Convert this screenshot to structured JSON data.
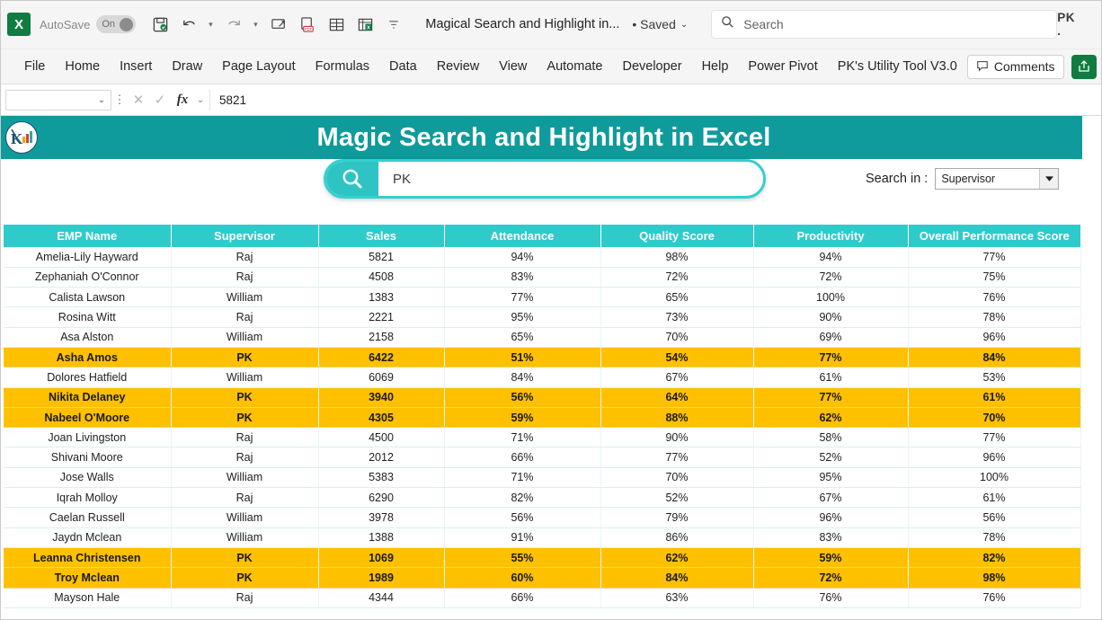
{
  "titlebar": {
    "app_icon": "excel-logo",
    "autosave_label": "AutoSave",
    "toggle_state": "On",
    "document_title": "Magical Search and Highlight in...",
    "saved_state": "• Saved",
    "search_placeholder": "Search",
    "account_initials": "PK .",
    "quick_access": [
      "save-icon",
      "undo-icon",
      "redo-icon",
      "quick-print-icon",
      "export-pdf-icon",
      "table-icon",
      "new-sheet-icon",
      "customize-qat-icon"
    ]
  },
  "ribbon": {
    "tabs": [
      {
        "label": "File"
      },
      {
        "label": "Home"
      },
      {
        "label": "Insert"
      },
      {
        "label": "Draw"
      },
      {
        "label": "Page Layout"
      },
      {
        "label": "Formulas"
      },
      {
        "label": "Data"
      },
      {
        "label": "Review"
      },
      {
        "label": "View"
      },
      {
        "label": "Automate"
      },
      {
        "label": "Developer"
      },
      {
        "label": "Help"
      },
      {
        "label": "Power Pivot"
      },
      {
        "label": "PK's Utility Tool V3.0"
      }
    ],
    "comments_label": "Comments",
    "share_label": "Share"
  },
  "formulabar": {
    "name_box_value": "",
    "cancel_icon": "cancel-icon",
    "enter_icon": "confirm-icon",
    "fx_label": "fx",
    "cell_value": "5821"
  },
  "banner": {
    "title": "Magic Search and Highlight in Excel",
    "background_color": "#0f9b9b",
    "logo": "pk-logo-icon"
  },
  "search": {
    "icon": "search-icon",
    "value": "PK",
    "accent_color": "#2fc4c4",
    "search_in_label": "Search in :",
    "search_in_value": "Supervisor"
  },
  "table": {
    "header_color": "#2fcbcb",
    "highlight_color": "#ffc000",
    "columns": [
      "EMP Name",
      "Supervisor",
      "Sales",
      "Attendance",
      "Quality Score",
      "Productivity",
      "Overall Performance Score"
    ],
    "rows": [
      {
        "name": "Amelia-Lily Hayward",
        "supervisor": "Raj",
        "sales": "5821",
        "attendance": "94%",
        "quality": "98%",
        "productivity": "94%",
        "overall": "77%",
        "highlighted": false
      },
      {
        "name": "Zephaniah O'Connor",
        "supervisor": "Raj",
        "sales": "4508",
        "attendance": "83%",
        "quality": "72%",
        "productivity": "72%",
        "overall": "75%",
        "highlighted": false
      },
      {
        "name": "Calista Lawson",
        "supervisor": "William",
        "sales": "1383",
        "attendance": "77%",
        "quality": "65%",
        "productivity": "100%",
        "overall": "76%",
        "highlighted": false
      },
      {
        "name": "Rosina Witt",
        "supervisor": "Raj",
        "sales": "2221",
        "attendance": "95%",
        "quality": "73%",
        "productivity": "90%",
        "overall": "78%",
        "highlighted": false
      },
      {
        "name": "Asa Alston",
        "supervisor": "William",
        "sales": "2158",
        "attendance": "65%",
        "quality": "70%",
        "productivity": "69%",
        "overall": "96%",
        "highlighted": false
      },
      {
        "name": "Asha Amos",
        "supervisor": "PK",
        "sales": "6422",
        "attendance": "51%",
        "quality": "54%",
        "productivity": "77%",
        "overall": "84%",
        "highlighted": true
      },
      {
        "name": "Dolores Hatfield",
        "supervisor": "William",
        "sales": "6069",
        "attendance": "84%",
        "quality": "67%",
        "productivity": "61%",
        "overall": "53%",
        "highlighted": false
      },
      {
        "name": "Nikita Delaney",
        "supervisor": "PK",
        "sales": "3940",
        "attendance": "56%",
        "quality": "64%",
        "productivity": "77%",
        "overall": "61%",
        "highlighted": true
      },
      {
        "name": "Nabeel O'Moore",
        "supervisor": "PK",
        "sales": "4305",
        "attendance": "59%",
        "quality": "88%",
        "productivity": "62%",
        "overall": "70%",
        "highlighted": true
      },
      {
        "name": "Joan Livingston",
        "supervisor": "Raj",
        "sales": "4500",
        "attendance": "71%",
        "quality": "90%",
        "productivity": "58%",
        "overall": "77%",
        "highlighted": false
      },
      {
        "name": "Shivani Moore",
        "supervisor": "Raj",
        "sales": "2012",
        "attendance": "66%",
        "quality": "77%",
        "productivity": "52%",
        "overall": "96%",
        "highlighted": false
      },
      {
        "name": "Jose Walls",
        "supervisor": "William",
        "sales": "5383",
        "attendance": "71%",
        "quality": "70%",
        "productivity": "95%",
        "overall": "100%",
        "highlighted": false
      },
      {
        "name": "Iqrah Molloy",
        "supervisor": "Raj",
        "sales": "6290",
        "attendance": "82%",
        "quality": "52%",
        "productivity": "67%",
        "overall": "61%",
        "highlighted": false
      },
      {
        "name": "Caelan Russell",
        "supervisor": "William",
        "sales": "3978",
        "attendance": "56%",
        "quality": "79%",
        "productivity": "96%",
        "overall": "56%",
        "highlighted": false
      },
      {
        "name": "Jaydn Mclean",
        "supervisor": "William",
        "sales": "1388",
        "attendance": "91%",
        "quality": "86%",
        "productivity": "83%",
        "overall": "78%",
        "highlighted": false
      },
      {
        "name": "Leanna Christensen",
        "supervisor": "PK",
        "sales": "1069",
        "attendance": "55%",
        "quality": "62%",
        "productivity": "59%",
        "overall": "82%",
        "highlighted": true
      },
      {
        "name": "Troy Mclean",
        "supervisor": "PK",
        "sales": "1989",
        "attendance": "60%",
        "quality": "84%",
        "productivity": "72%",
        "overall": "98%",
        "highlighted": true
      },
      {
        "name": "Mayson Hale",
        "supervisor": "Raj",
        "sales": "4344",
        "attendance": "66%",
        "quality": "63%",
        "productivity": "76%",
        "overall": "76%",
        "highlighted": false
      }
    ]
  }
}
